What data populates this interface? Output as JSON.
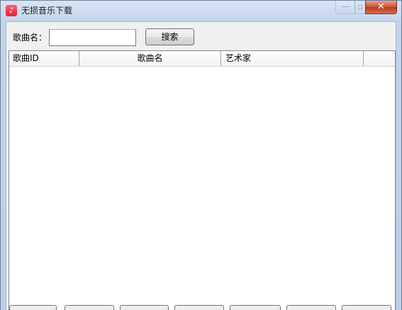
{
  "window": {
    "title": "无损音乐下载",
    "close_glyph": "✕",
    "minimize_glyph": "—",
    "maximize_glyph": "▫"
  },
  "search": {
    "label": "歌曲名：",
    "value": "",
    "placeholder": "",
    "button_label": "搜索"
  },
  "list": {
    "columns": [
      "歌曲ID",
      "歌曲名",
      "艺术家",
      ""
    ],
    "rows": []
  },
  "icons": {
    "app": "music-note-icon",
    "close": "close-icon",
    "minimize": "minimize-icon",
    "maximize": "maximize-icon"
  },
  "colors": {
    "close_button": "#c8442a",
    "title_bar": "#c8d8ec",
    "list_background": "#ffffff"
  }
}
